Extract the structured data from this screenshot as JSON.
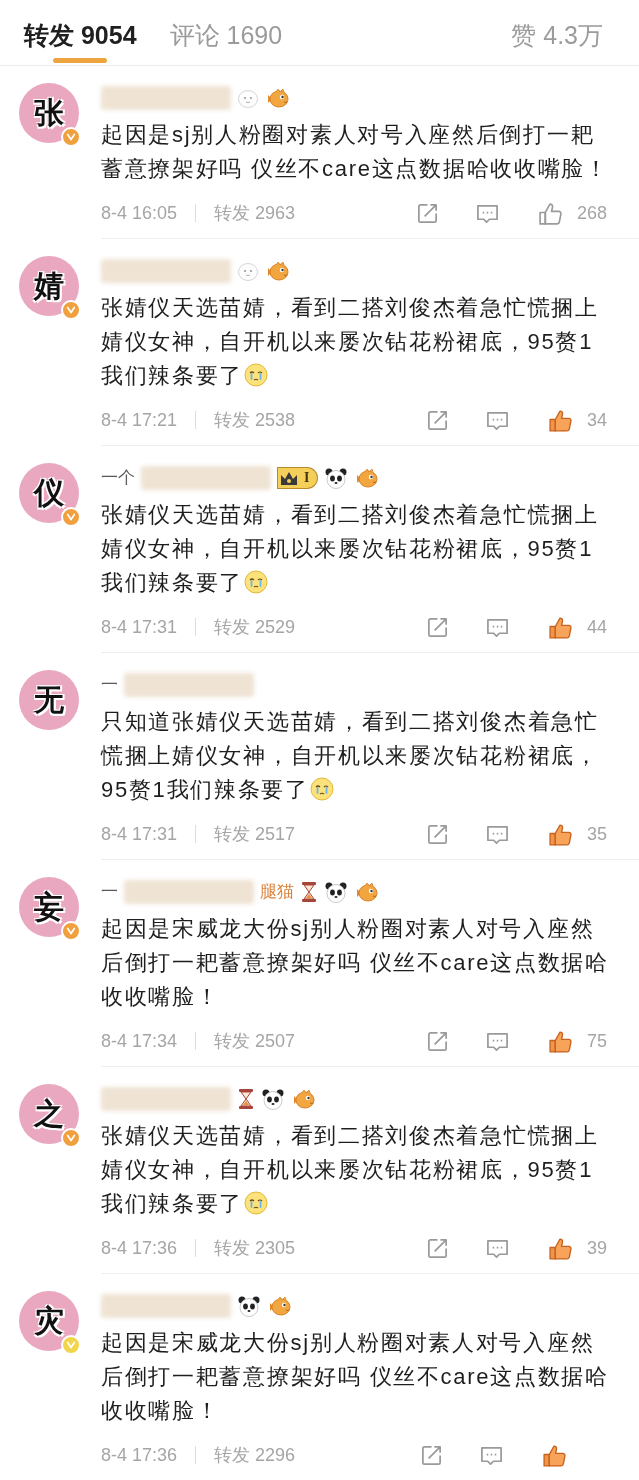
{
  "tabs": [
    {
      "label": "转发 9054",
      "selected": true
    },
    {
      "label": "评论 1690",
      "selected": false
    },
    {
      "label": "赞 4.3万",
      "selected": false
    }
  ],
  "comments": [
    {
      "avatar": "张",
      "verified_badge": {
        "color": "#f0a03e"
      },
      "badges": [
        {
          "kind": "smiley"
        },
        {
          "kind": "fish"
        }
      ],
      "text": "起因是sj别人粉圈对素人对号入座然后倒打一耙蓄意撩架好吗 仪丝不care这点数据哈收收嘴脸！",
      "trailing_emoji": false,
      "time": "8-4 16:05",
      "reposts": "转发 2963",
      "likes": "268",
      "liked": false
    },
    {
      "avatar": "婧",
      "verified_badge": {
        "color": "#f0a03e"
      },
      "badges": [
        {
          "kind": "smiley"
        },
        {
          "kind": "fish"
        }
      ],
      "text": "张婧仪天选苗婧，看到二搭刘俊杰着急忙慌捆上婧仪女神，自开机以来屡次钻花粉裙底，95赘1我们辣条要了",
      "trailing_emoji": true,
      "time": "8-4 17:21",
      "reposts": "转发 2538",
      "likes": "34",
      "liked": true
    },
    {
      "avatar": "仪",
      "verified_badge": {
        "color": "#f0a03e"
      },
      "name_prefix": "一个",
      "badges": [
        {
          "kind": "level",
          "text": "I"
        },
        {
          "kind": "panda"
        },
        {
          "kind": "fish"
        }
      ],
      "text": "张婧仪天选苗婧，看到二搭刘俊杰着急忙慌捆上婧仪女神，自开机以来屡次钻花粉裙底，95赘1我们辣条要了",
      "trailing_emoji": true,
      "time": "8-4 17:31",
      "reposts": "转发 2529",
      "likes": "44",
      "liked": true
    },
    {
      "avatar": "无",
      "name_prefix": "一",
      "text": "只知道张婧仪天选苗婧，看到二搭刘俊杰着急忙慌捆上婧仪女神，自开机以来屡次钻花粉裙底，95赘1我们辣条要了",
      "trailing_emoji": true,
      "time": "8-4 17:31",
      "reposts": "转发 2517",
      "likes": "35",
      "liked": true
    },
    {
      "avatar": "妄",
      "verified_badge": {
        "color": "#f0a03e"
      },
      "name_prefix": "一",
      "name_suffix": "腿猫",
      "badges": [
        {
          "kind": "hourglass"
        },
        {
          "kind": "panda"
        },
        {
          "kind": "fish"
        }
      ],
      "text": "起因是宋威龙大份sj别人粉圈对素人对号入座然后倒打一耙蓄意撩架好吗 仪丝不care这点数据哈收收嘴脸！",
      "trailing_emoji": false,
      "time": "8-4 17:34",
      "reposts": "转发 2507",
      "likes": "75",
      "liked": true
    },
    {
      "avatar": "之",
      "verified_badge": {
        "color": "#f0a03e"
      },
      "badges": [
        {
          "kind": "hourglass"
        },
        {
          "kind": "panda"
        },
        {
          "kind": "fish"
        }
      ],
      "text": "张婧仪天选苗婧，看到二搭刘俊杰着急忙慌捆上婧仪女神，自开机以来屡次钻花粉裙底，95赘1我们辣条要了",
      "trailing_emoji": true,
      "time": "8-4 17:36",
      "reposts": "转发 2305",
      "likes": "39",
      "liked": true
    },
    {
      "avatar": "灾",
      "verified_badge": {
        "color": "#f2d54c"
      },
      "badges": [
        {
          "kind": "panda"
        },
        {
          "kind": "fish"
        }
      ],
      "text": "起因是宋威龙大份sj别人粉圈对素人对号入座然后倒打一耙蓄意撩架好吗 仪丝不care这点数据哈收收嘴脸！",
      "trailing_emoji": false,
      "time": "8-4 17:36",
      "reposts": "转发 2296",
      "liked": true
    }
  ]
}
